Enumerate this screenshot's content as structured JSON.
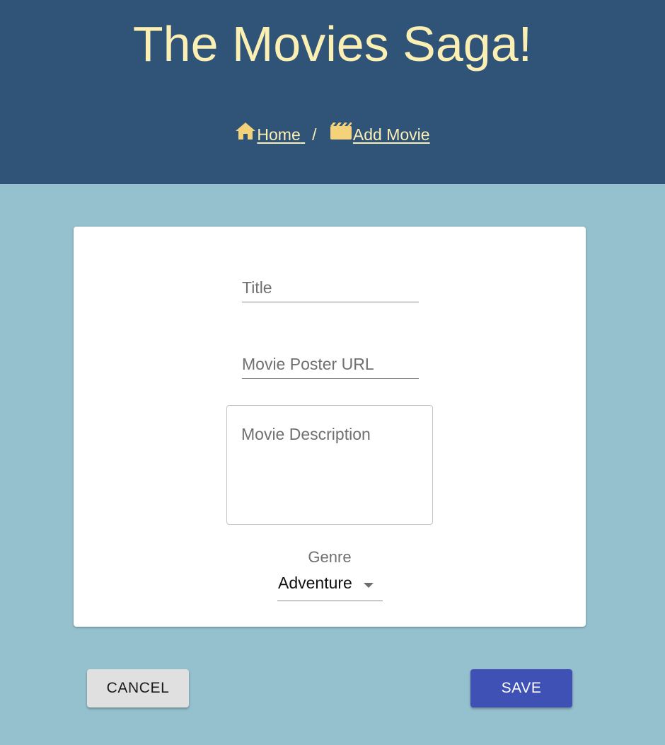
{
  "header": {
    "title": "The Movies Saga!",
    "breadcrumb": {
      "home_icon": "home-icon",
      "home_label": "Home",
      "separator": "/",
      "movie_icon": "movie-clapperboard-icon",
      "current_label": "Add Movie"
    }
  },
  "form": {
    "title_placeholder": "Title",
    "title_value": "",
    "poster_placeholder": "Movie Poster URL",
    "poster_value": "",
    "description_placeholder": "Movie Description",
    "description_value": "",
    "genre_label": "Genre",
    "genre_value": "Adventure"
  },
  "actions": {
    "cancel_label": "CANCEL",
    "save_label": "SAVE"
  },
  "colors": {
    "header_bg": "#2f5478",
    "title_text": "#fcefb4",
    "page_bg": "#95c0ce",
    "save_button": "#3f51b5",
    "cancel_button": "#e0e0e0"
  }
}
